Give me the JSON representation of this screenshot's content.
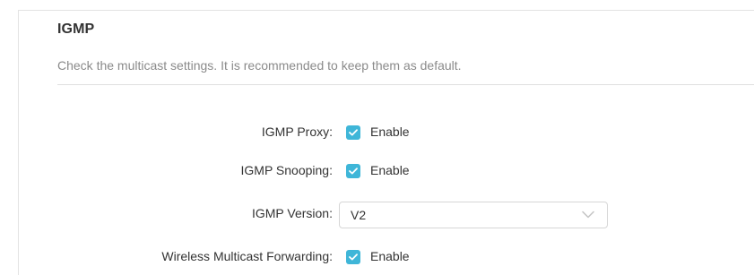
{
  "section": {
    "title": "IGMP",
    "description": "Check the multicast settings. It is recommended to keep them as default."
  },
  "fields": {
    "igmp_proxy": {
      "label": "IGMP Proxy:",
      "checkbox_label": "Enable",
      "checked": true
    },
    "igmp_snooping": {
      "label": "IGMP Snooping:",
      "checkbox_label": "Enable",
      "checked": true
    },
    "igmp_version": {
      "label": "IGMP Version:",
      "selected": "V2",
      "icon": "chevron-down-icon"
    },
    "wireless_multicast_forwarding": {
      "label": "Wireless Multicast Forwarding:",
      "checkbox_label": "Enable",
      "checked": true
    }
  },
  "colors": {
    "checkbox_accent": "#3fb6d8",
    "title_text": "#333333",
    "description_text": "#8a8a8a",
    "divider": "#e0e0e0"
  }
}
